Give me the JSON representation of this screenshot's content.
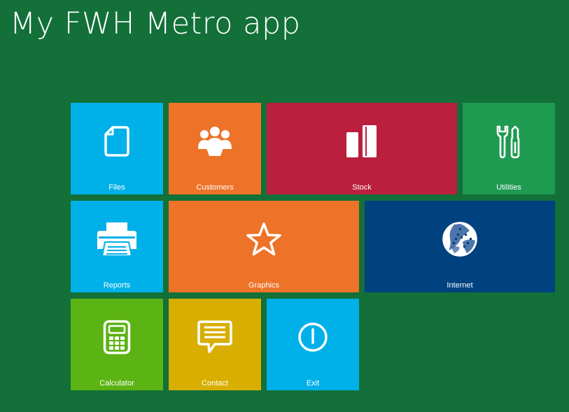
{
  "header": {
    "title": "My FWH Metro app"
  },
  "tiles": [
    {
      "label": "Files",
      "icon": "document-icon",
      "color": "#00B0E8"
    },
    {
      "label": "Customers",
      "icon": "users-group-icon",
      "color": "#ED7328"
    },
    {
      "label": "Stock",
      "icon": "bar-chart-icon",
      "color": "#BA1F3D"
    },
    {
      "label": "Utilities",
      "icon": "tools-icon",
      "color": "#1F9A51"
    },
    {
      "label": "Reports",
      "icon": "printer-icon",
      "color": "#00B0E8"
    },
    {
      "label": "Graphics",
      "icon": "star-icon",
      "color": "#ED7328"
    },
    {
      "label": "Internet",
      "icon": "globe-icon",
      "color": "#004280"
    },
    {
      "label": "Calculator",
      "icon": "calculator-icon",
      "color": "#5CB314"
    },
    {
      "label": "Contact",
      "icon": "chat-bubble-icon",
      "color": "#D8AE00"
    },
    {
      "label": "Exit",
      "icon": "power-icon",
      "color": "#00B0E8"
    }
  ],
  "colors": {
    "background": "#127038",
    "text": "#FFFFFF"
  }
}
